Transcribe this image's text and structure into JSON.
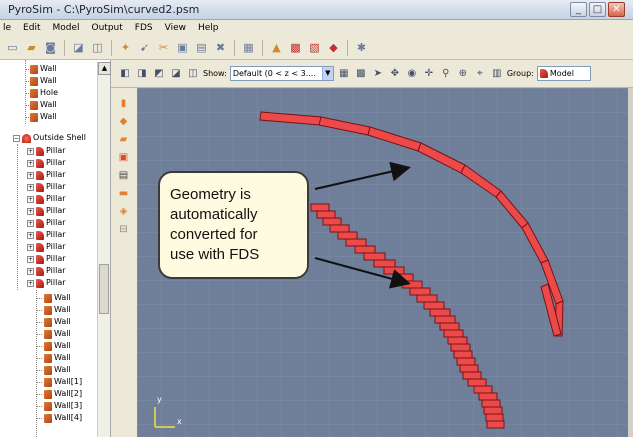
{
  "window": {
    "title": "PyroSim - C:\\PyroSim\\curved2.psm",
    "buttons": [
      "_",
      "□",
      "✕"
    ]
  },
  "menubar": {
    "items": [
      "le",
      "Edit",
      "Model",
      "Output",
      "FDS",
      "View",
      "Help"
    ]
  },
  "viewtoolbar": {
    "show_label": "Show:",
    "show_value": "Default (0 < z < 3....",
    "group_label": "Group:",
    "group_value": "Model"
  },
  "tree": {
    "items_top": [
      "Wall",
      "Wall",
      "Hole",
      "Wall",
      "Wall"
    ],
    "shell_label": "Outside Shell",
    "pillars": [
      "Pillar",
      "Pillar",
      "Pillar",
      "Pillar",
      "Pillar",
      "Pillar",
      "Pillar",
      "Pillar",
      "Pillar",
      "Pillar",
      "Pillar",
      "Pillar"
    ],
    "walls": [
      "Wall",
      "Wall",
      "Wall",
      "Wall",
      "Wall",
      "Wall",
      "Wall",
      "Wall[1]",
      "Wall[2]",
      "Wall[3]",
      "Wall[4]"
    ]
  },
  "callout": {
    "lines": [
      "Geometry is",
      "automatically",
      "converted for",
      "use with FDS"
    ]
  },
  "axes": {
    "y_label": "y",
    "x_label": "x"
  },
  "colors": {
    "viewport_bg": "#6f7e99",
    "grid": "#8190a9",
    "geometry_fill": "#ec4a4a",
    "geometry_stroke": "#7a1212",
    "callout_bg": "#fffbe0"
  }
}
